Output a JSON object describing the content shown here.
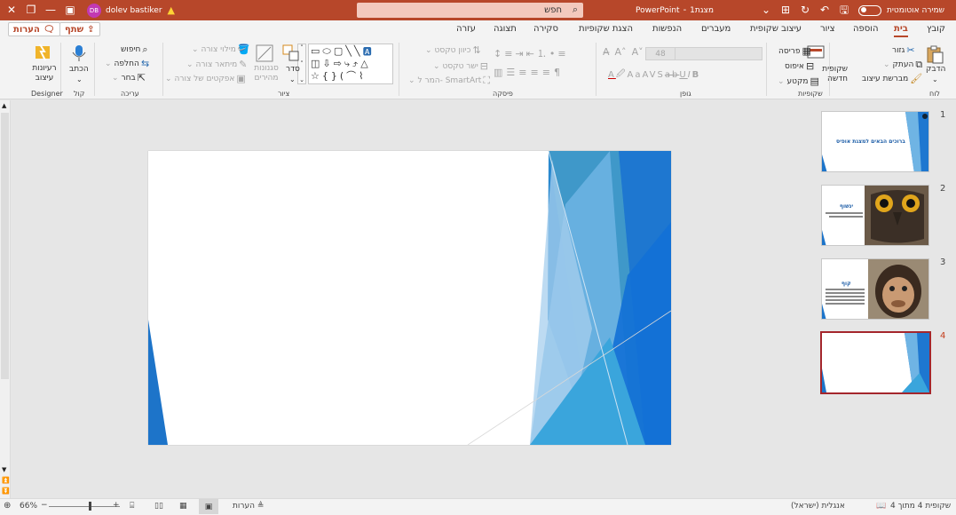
{
  "titlebar": {
    "autosave_label": "שמירה אוטומטית",
    "doc_title": "מצגת1",
    "app_name": "PowerPoint",
    "search_placeholder": "חפש",
    "user_name": "dolev bastiker",
    "user_initials": "DB"
  },
  "tabs": [
    {
      "label": "קובץ",
      "active": false
    },
    {
      "label": "בית",
      "active": true
    },
    {
      "label": "הוספה",
      "active": false
    },
    {
      "label": "ציור",
      "active": false
    },
    {
      "label": "עיצוב שקופית",
      "active": false
    },
    {
      "label": "מעברים",
      "active": false
    },
    {
      "label": "הנפשות",
      "active": false
    },
    {
      "label": "הצגת שקופיות",
      "active": false
    },
    {
      "label": "סקירה",
      "active": false
    },
    {
      "label": "תצוגה",
      "active": false
    },
    {
      "label": "עזרה",
      "active": false
    }
  ],
  "share_label": "שתף",
  "comments_label": "הערות",
  "ribbon": {
    "clipboard": {
      "label": "לוח",
      "paste": "הדבק",
      "cut": "גזור",
      "copy": "העתק",
      "format_painter": "מברשת עיצוב"
    },
    "slides": {
      "label": "שקופיות",
      "new_slide": "שקופית חדשה",
      "layout": "פריסה",
      "reset": "איפוס",
      "section": "מקטע"
    },
    "font": {
      "label": "גופן",
      "size": "48"
    },
    "paragraph": {
      "label": "פיסקה",
      "text_direction": "כיוון טקסט",
      "align_text": "ישר טקסט",
      "smartart": "המר ל- SmartArt"
    },
    "drawing": {
      "label": "ציור",
      "arrange": "סדר",
      "quick_styles": "סגנונות מהירים",
      "shape_fill": "מילוי צורה",
      "shape_outline": "מיתאר צורה",
      "shape_effects": "אפקטים של צורה"
    },
    "editing": {
      "label": "עריכה",
      "find": "חיפוש",
      "replace": "החלפה",
      "select": "בחר"
    },
    "voice": {
      "label": "קול",
      "dictate": "הכתב"
    },
    "designer": {
      "label": "Designer",
      "design_ideas": "רעיונות עיצוב"
    }
  },
  "slides": [
    {
      "number": "1",
      "title": "ברוכים הבאים למצגת אופיס"
    },
    {
      "number": "2",
      "title": "ינשוף"
    },
    {
      "number": "3",
      "title": "קוף"
    },
    {
      "number": "4",
      "title": ""
    }
  ],
  "status": {
    "slide_counter": "שקופית 4 מתוך 4",
    "language": "אנגלית (ישראל)",
    "notes": "הערות",
    "zoom": "66%"
  },
  "colors": {
    "accent": "#b7472a",
    "theme_dark_blue": "#0f6fc6",
    "theme_light_blue": "#3aa5dc"
  }
}
